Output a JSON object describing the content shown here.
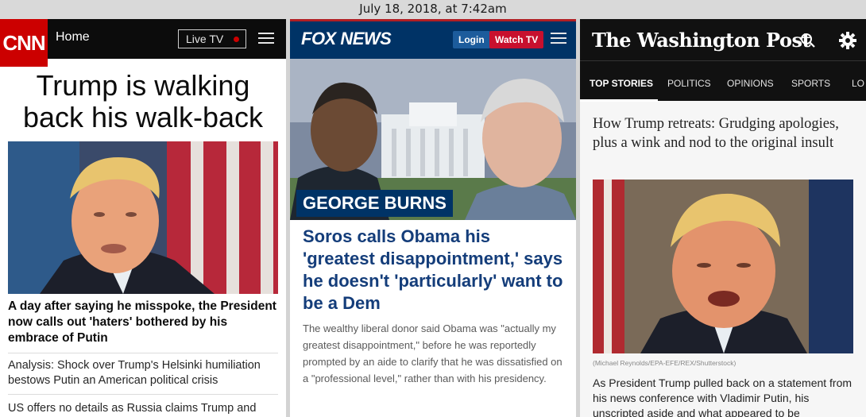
{
  "screenshot_caption": "July 18, 2018, at 7:42am",
  "cnn": {
    "logo": "CNN",
    "nav_home": "Home",
    "live_tv": "Live TV",
    "main_title": "Trump is walking back his walk-back",
    "headline": "A day after saying he misspoke, the President now calls out 'haters' bothered by his embrace of Putin",
    "stories": [
      "Analysis: Shock over Trump's Helsinki humiliation bestows Putin an American political crisis",
      "US offers no details as Russia claims Trump and"
    ],
    "icons": [
      "menu-icon",
      "live-dot-icon"
    ]
  },
  "fox": {
    "logo": "FOX NEWS",
    "login": "Login",
    "watch_tv": "Watch TV",
    "image_tag": "GEORGE BURNS",
    "headline": "Soros calls Obama his 'greatest disappointment,' says he doesn't 'particularly' want to be a Dem",
    "body": "The wealthy liberal donor said Obama was \"actually my greatest disappointment,\" before he was reportedly prompted by an aide to clarify that he was dissatisfied on a \"professional level,\" rather than with his presidency.",
    "body_more": "",
    "icons": [
      "menu-icon"
    ]
  },
  "wapo": {
    "logo": "The Washington Post",
    "tabs": [
      "TOP STORIES",
      "POLITICS",
      "OPINIONS",
      "SPORTS",
      "LO"
    ],
    "active_tab": "TOP STORIES",
    "headline": "How Trump retreats: Grudging apologies, plus a wink and nod to the original insult",
    "photo_credit": "(Michael Reynolds/EPA-EFE/REX/Shutterstock)",
    "body": "As President Trump pulled back on a statement from his news conference with Vladimir Putin, his unscripted aside and what appeared to be",
    "icons": [
      "search-icon",
      "gear-icon"
    ]
  }
}
